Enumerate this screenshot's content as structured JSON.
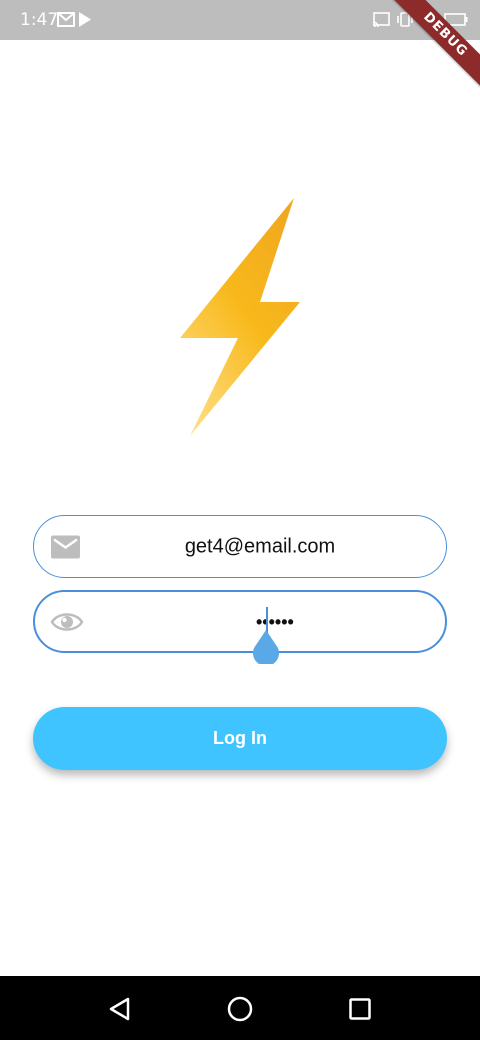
{
  "status_bar": {
    "time": "1:47",
    "left_icons": [
      "gmail-icon",
      "play-store-icon"
    ],
    "right_icons": [
      "cast-icon",
      "vibrate-icon",
      "wifi-icon",
      "battery-icon"
    ]
  },
  "debug_banner": {
    "label": "DEBUG"
  },
  "logo": {
    "icon": "lightning-bolt-icon",
    "colors": [
      "#fbc02d",
      "#f5a623",
      "#ffe082"
    ]
  },
  "form": {
    "email": {
      "icon": "email-icon",
      "value": "get4@email.com"
    },
    "password": {
      "icon": "eye-icon",
      "value": "••••••"
    },
    "login_button": {
      "label": "Log In"
    }
  },
  "colors": {
    "accent": "#40c4ff",
    "field_border": "#4a90d9",
    "status_bar": "#bdbdbd",
    "nav_bar": "#000000",
    "icon_gray": "#bdbdbd"
  },
  "nav_bar": {
    "buttons": [
      "back-icon",
      "home-icon",
      "recents-icon"
    ]
  }
}
